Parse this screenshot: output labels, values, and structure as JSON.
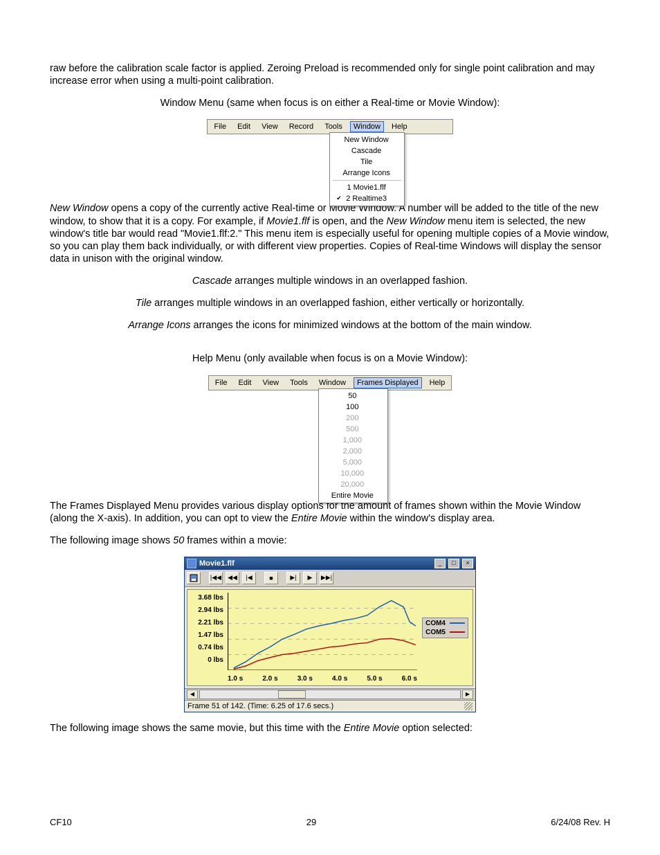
{
  "intro_para": "raw before the calibration scale factor is applied. Zeroing Preload is recommended only for single point calibration and may increase error when using a multi-point calibration.",
  "window_menu_caption": "Window Menu (same when focus is on either a Real-time or Movie Window):",
  "menubar": {
    "file": "File",
    "edit": "Edit",
    "view": "View",
    "record": "Record",
    "tools": "Tools",
    "window": "Window",
    "help": "Help"
  },
  "window_menu_items": {
    "new_window": "New Window",
    "cascade": "Cascade",
    "tile": "Tile",
    "arrange_icons": "Arrange Icons",
    "doc1": "1 Movie1.flf",
    "doc2": "2 Realtime3"
  },
  "new_window_label": "New Window",
  "new_window_para_a": " opens a copy of the currently active Real-time or Movie Window. A number will be added to the title of the new window, to show that it is a copy. For example, if ",
  "new_window_movie_ref": "Movie1.flf",
  "new_window_para_b": " is open, and the ",
  "new_window_menu_ref": "New Window",
  "new_window_para_c": " menu item is selected, the new window's title bar would read \"Movie1.flf:2.\" This menu item is especially useful for opening multiple copies of a Movie window, so you can play them back individually, or with different view properties. Copies of Real-time Windows will display the sensor data in unison with the original window.",
  "cascade_label": "Cascade",
  "cascade_text": " arranges multiple windows in an overlapped fashion.",
  "tile_label": "Tile",
  "tile_text": " arranges multiple windows in an overlapped fashion, either vertically or horizontally.",
  "arrange_label": "Arrange Icons",
  "arrange_text": " arranges the icons for minimized windows at the bottom of the main window.",
  "help_menu_caption": "Help Menu (only available when focus is on a Movie Window):",
  "menubar2": {
    "file": "File",
    "edit": "Edit",
    "view": "View",
    "tools": "Tools",
    "window": "Window",
    "frames": "Frames Displayed",
    "help": "Help"
  },
  "frames_menu_items": [
    "50",
    "100",
    "200",
    "500",
    "1,000",
    "2,000",
    "5,000",
    "10,000",
    "20,000",
    "Entire Movie"
  ],
  "frames_para_a": "The Frames Displayed Menu provides various display options for the amount of frames shown within the Movie Window (along the X-axis). In addition, you can opt to view the ",
  "frames_para_em": "Entire Movie",
  "frames_para_b": " within the window's display area.",
  "fifty_intro_a": "The following image shows ",
  "fifty_intro_em": "50",
  "fifty_intro_b": " frames within a movie:",
  "movie_window": {
    "title": "Movie1.flf",
    "status": "Frame 51 of 142. (Time: 6.25 of 17.6 secs.)"
  },
  "chart_data": {
    "type": "line",
    "y_ticks": [
      "3.68 lbs",
      "2.94 lbs",
      "2.21 lbs",
      "1.47 lbs",
      "0.74 lbs",
      "0 lbs"
    ],
    "x_ticks": [
      "1.0 s",
      "2.0 s",
      "3.0 s",
      "4.0 s",
      "5.0 s",
      "6.0 s"
    ],
    "xlim": [
      0.0,
      6.25
    ],
    "ylim": [
      0,
      3.68
    ],
    "legend": [
      {
        "name": "COM4",
        "color": "#1e5fb8"
      },
      {
        "name": "COM5",
        "color": "#b01212"
      }
    ],
    "x": [
      0.2,
      0.6,
      1.0,
      1.4,
      1.8,
      2.2,
      2.6,
      3.0,
      3.4,
      3.8,
      4.2,
      4.6,
      5.0,
      5.4,
      5.8,
      6.0,
      6.2
    ],
    "series": [
      {
        "name": "COM4",
        "color": "#1e5fb8",
        "values": [
          0.1,
          0.4,
          0.8,
          1.1,
          1.47,
          1.7,
          1.95,
          2.1,
          2.21,
          2.35,
          2.45,
          2.6,
          3.0,
          3.3,
          3.0,
          2.3,
          2.1
        ]
      },
      {
        "name": "COM5",
        "color": "#b01212",
        "values": [
          0.05,
          0.2,
          0.45,
          0.6,
          0.74,
          0.8,
          0.9,
          1.0,
          1.1,
          1.15,
          1.25,
          1.3,
          1.47,
          1.5,
          1.4,
          1.3,
          1.2
        ]
      }
    ]
  },
  "entire_intro_a": "The following image shows the same movie, but this time with the ",
  "entire_intro_em": "Entire Movie",
  "entire_intro_b": " option selected:",
  "footer": {
    "left": "CF10",
    "center": "29",
    "right": "6/24/08 Rev. H"
  }
}
